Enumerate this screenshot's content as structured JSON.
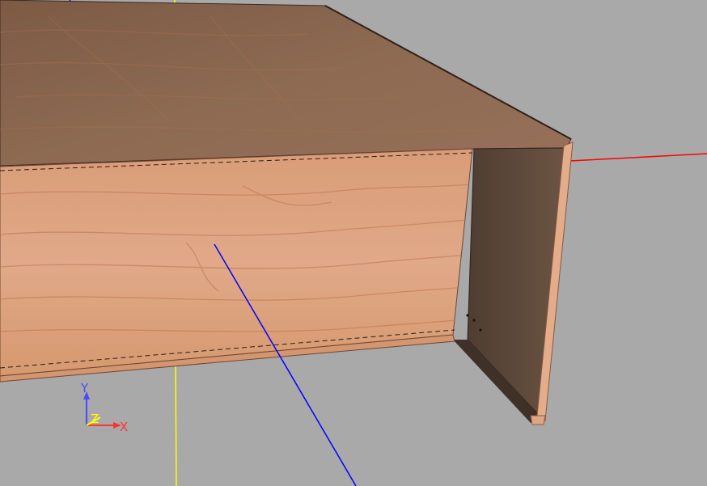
{
  "viewport": {
    "background": "#a9a9a9"
  },
  "axes": {
    "x_color": "#ff0000",
    "y_color": "#ffff00",
    "z_color": "#0000ff"
  },
  "model": {
    "material": "wood",
    "top_color": "#86614a",
    "front_color": "#dba07d",
    "interior_color": "#5e4a3c",
    "edge_color": "#c88a62"
  },
  "gizmo": {
    "x_label": "X",
    "y_label": "Y",
    "z_label": "Z",
    "x_color": "#ff3333",
    "y_color": "#4a4aff",
    "z_color": "#ffff00"
  }
}
